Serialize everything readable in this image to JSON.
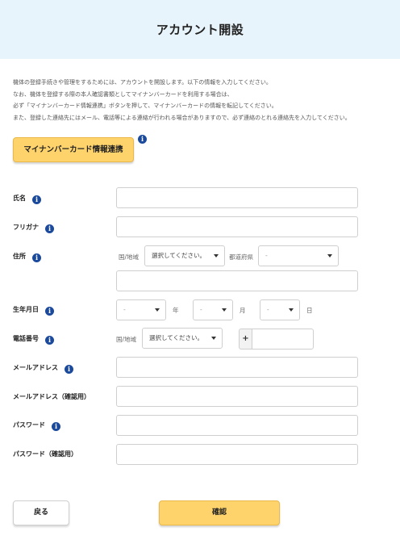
{
  "header": {
    "title": "アカウント開設"
  },
  "intro": {
    "lines": [
      "機体の登録手続きや管理をするためには、アカウントを開設します。以下の情報を入力してください。",
      "なお、機体を登録する際の本人確認書類としてマイナンバーカードを利用する場合は、",
      "必ず「マイナンバーカード情報連携」ボタンを押して、マイナンバーカードの情報を転記してください。",
      "また、登録した連絡先にはメール、電話等による連絡が行われる場合がありますので、必ず連絡のとれる連絡先を入力してください。"
    ]
  },
  "mynumber_button": {
    "label": "マイナンバーカード情報連携",
    "info_icon": "i"
  },
  "form": {
    "name": {
      "label": "氏名",
      "value": ""
    },
    "furigana": {
      "label": "フリガナ",
      "value": ""
    },
    "address": {
      "label": "住所",
      "country_label": "国/地域",
      "country_value": "選択してください。",
      "prefecture_label": "都道府県",
      "prefecture_value": "-",
      "line_value": ""
    },
    "birthdate": {
      "label": "生年月日",
      "year_value": "-",
      "year_unit": "年",
      "month_value": "-",
      "month_unit": "月",
      "day_value": "-",
      "day_unit": "日"
    },
    "phone": {
      "label": "電話番号",
      "country_label": "国/地域",
      "country_value": "選択してください。",
      "plus": "+",
      "number_value": ""
    },
    "email": {
      "label": "メールアドレス",
      "value": ""
    },
    "email_confirm": {
      "label": "メールアドレス（確認用）",
      "value": ""
    },
    "password": {
      "label": "パスワード",
      "value": ""
    },
    "password_confirm": {
      "label": "パスワード（確認用）",
      "value": ""
    }
  },
  "footer": {
    "back_label": "戻る",
    "confirm_label": "確認"
  },
  "colors": {
    "header_bg": "#e8f4fb",
    "accent": "#ffd36b",
    "info_icon": "#1b4a9c"
  },
  "icons": {
    "info": "info-icon",
    "caret": "chevron-down-icon"
  }
}
